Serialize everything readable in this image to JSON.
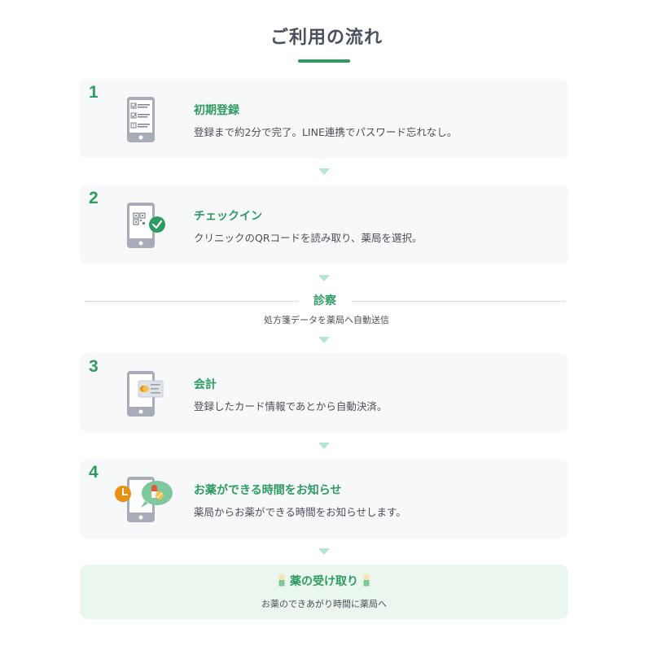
{
  "page": {
    "title": "ご利用の流れ"
  },
  "steps": [
    {
      "number": "1",
      "heading": "初期登録",
      "description": "登録まで約2分で完了。LINE連携でパスワード忘れなし。",
      "icon": "phone-checklist-icon"
    },
    {
      "number": "2",
      "heading": "チェックイン",
      "description": "クリニックのQRコードを読み取り、薬局を選択。",
      "icon": "phone-qr-check-icon"
    },
    {
      "number": "3",
      "heading": "会計",
      "description": "登録したカード情報であとから自動決済。",
      "icon": "phone-credit-card-icon"
    },
    {
      "number": "4",
      "heading": "お薬ができる時間をお知らせ",
      "description": "薬局からお薬ができる時間をお知らせします。",
      "icon": "phone-clock-notification-icon"
    }
  ],
  "diagnosis": {
    "label": "診察",
    "sub": "処方箋データを薬局へ自動送信"
  },
  "final": {
    "heading": "薬の受け取り",
    "sub": "お薬のできあがり時間に薬局へ",
    "icon": "capsule-icon"
  },
  "colors": {
    "accent": "#2e9b62",
    "card_bg": "#f7f8fa",
    "final_bg": "#ebf6ef",
    "arrow": "#b7e4cf",
    "title": "#4a505c",
    "text": "#4a4f57",
    "icon_gray": "#a6adb8",
    "orange": "#e8900f",
    "red": "#e0593f"
  }
}
